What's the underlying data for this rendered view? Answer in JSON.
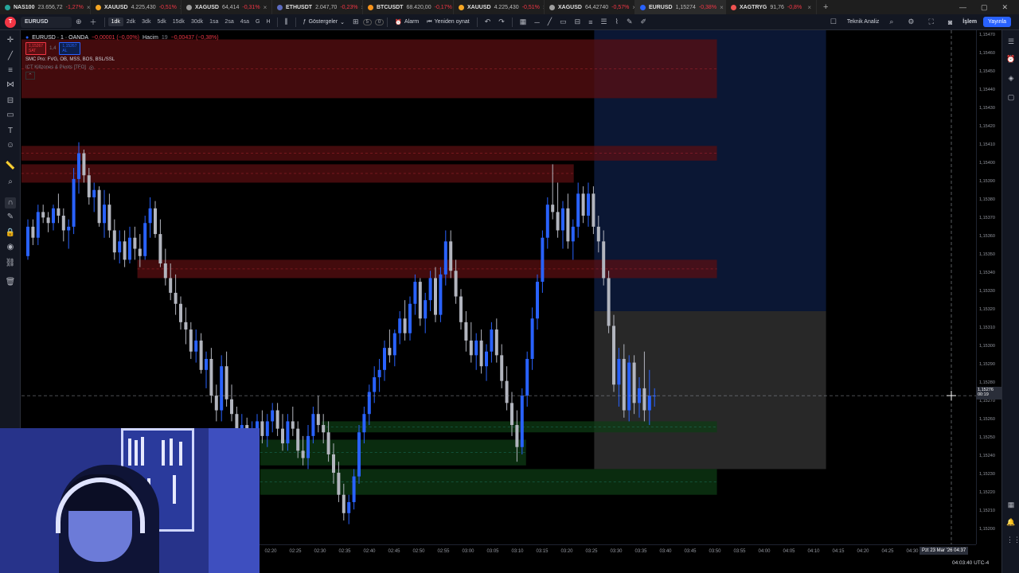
{
  "browser_tabs": [
    {
      "symbol": "NAS100",
      "price": "23.656,72",
      "change": "-1,27%",
      "color": "#26a69a"
    },
    {
      "symbol": "XAUUSD",
      "price": "4.225,430",
      "change": "-0,51%",
      "color": "#f5a623"
    },
    {
      "symbol": "XAGUSD",
      "price": "64,414",
      "change": "-0,31%",
      "color": "#9e9e9e"
    },
    {
      "symbol": "ETHUSDT",
      "price": "2.047,70",
      "change": "-0,23%",
      "color": "#5c6bc0"
    },
    {
      "symbol": "BTCUSDT",
      "price": "68.420,00",
      "change": "-0,17%",
      "color": "#f7931a"
    },
    {
      "symbol": "XAUUSD",
      "price": "4.225,430",
      "change": "-0,51%",
      "color": "#f5a623"
    },
    {
      "symbol": "XAGUSD",
      "price": "64,42740",
      "change": "-0,57%",
      "color": "#9e9e9e"
    },
    {
      "symbol": "EURUSD",
      "price": "1,15274",
      "change": "-0,38%",
      "color": "#2962ff",
      "active": true
    },
    {
      "symbol": "XAGTRYG",
      "price": "91,76",
      "change": "-0,8%",
      "color": "#ef5350"
    }
  ],
  "toolbar": {
    "symbol": "EURUSD",
    "timeframes": [
      "1dk",
      "2dk",
      "3dk",
      "5dk",
      "15dk",
      "30dk",
      "1sa",
      "2sa",
      "4sa",
      "G",
      "H"
    ],
    "active_timeframe": "1dk",
    "indicators_label": "Göstergeler",
    "indicator_count": "5",
    "indicator_count2": "0",
    "alarm_label": "Alarm",
    "replay_label": "Yeniden oynat",
    "tech_analysis_label": "Teknik Analiz",
    "trade_label": "İşlem",
    "publish_label": "Yayınla"
  },
  "legend": {
    "title": "EURUSD · 1 · OANDA",
    "ohlc_change": "−0,00001 (−0,00%)",
    "volume_label": "Hacim",
    "volume_value": "19",
    "change2": "−0,00437 (−0,38%)",
    "sell_price": "1,15267",
    "sell_label": "SAT",
    "spread": "1,4",
    "buy_price": "1,15267",
    "buy_label": "AL",
    "indicator1": "SMC Pro: FVG, OB, MSS, BOS, BSL/SSL",
    "indicator2": "ICT Killzones & Pivots [TFO]"
  },
  "price_axis": {
    "ticks": [
      "1,15470",
      "1,15460",
      "1,15450",
      "1,15440",
      "1,15430",
      "1,15420",
      "1,15410",
      "1,15400",
      "1,15390",
      "1,15380",
      "1,15370",
      "1,15360",
      "1,15350",
      "1,15340",
      "1,15330",
      "1,15320",
      "1,15310",
      "1,15300",
      "1,15290",
      "1,15280",
      "1,15270",
      "1,15260",
      "1,15250",
      "1,15240",
      "1,15230",
      "1,15220",
      "1,15210",
      "1,15200"
    ],
    "current_price": "1,15276",
    "countdown": "00:19"
  },
  "time_axis": {
    "ticks": [
      "02:20",
      "02:25",
      "02:30",
      "02:35",
      "02:40",
      "02:45",
      "02:50",
      "02:55",
      "03:00",
      "03:05",
      "03:10",
      "03:15",
      "03:20",
      "03:25",
      "03:30",
      "03:35",
      "03:40",
      "03:45",
      "03:50",
      "03:55",
      "04:00",
      "04:05",
      "04:10",
      "04:15",
      "04:20",
      "04:25",
      "04:30"
    ],
    "date_tag": "Pzt 23 Mar '26  04:37",
    "clock": "04:03:40 UTC-4"
  },
  "colors": {
    "bull": "#2962ff",
    "bear": "#b2b5be",
    "supply_zone": "#5a0f12",
    "demand_zone": "#0d3b14",
    "target_zone": "#0c1a3a",
    "stop_zone": "#2f2f2f"
  },
  "chart_data": {
    "type": "candlestick",
    "title": "EURUSD · 1 · OANDA",
    "x_range": [
      "02:13",
      "04:33"
    ],
    "ylim": [
      1.15195,
      1.15475
    ],
    "candles": [
      [
        1.15352,
        1.15372,
        1.1535,
        1.15368
      ],
      [
        1.15368,
        1.15372,
        1.15358,
        1.15362
      ],
      [
        1.15362,
        1.1538,
        1.15358,
        1.15376
      ],
      [
        1.15376,
        1.1538,
        1.1537,
        1.15373
      ],
      [
        1.15373,
        1.15376,
        1.15365,
        1.1537
      ],
      [
        1.1537,
        1.1538,
        1.15366,
        1.15378
      ],
      [
        1.15378,
        1.15386,
        1.1537,
        1.15374
      ],
      [
        1.15374,
        1.15378,
        1.1536,
        1.15366
      ],
      [
        1.15366,
        1.15372,
        1.15356,
        1.15368
      ],
      [
        1.15368,
        1.154,
        1.15364,
        1.15394
      ],
      [
        1.15394,
        1.15414,
        1.15386,
        1.15408
      ],
      [
        1.15408,
        1.1541,
        1.15392,
        1.15396
      ],
      [
        1.15396,
        1.154,
        1.1538,
        1.15384
      ],
      [
        1.15384,
        1.15392,
        1.15376,
        1.15388
      ],
      [
        1.15388,
        1.1539,
        1.15368,
        1.1537
      ],
      [
        1.1537,
        1.15388,
        1.15362,
        1.1538
      ],
      [
        1.1538,
        1.15386,
        1.15362,
        1.15366
      ],
      [
        1.15366,
        1.15372,
        1.1535,
        1.15354
      ],
      [
        1.15354,
        1.15366,
        1.15348,
        1.1536
      ],
      [
        1.1536,
        1.15366,
        1.15346,
        1.1535
      ],
      [
        1.1535,
        1.15368,
        1.15348,
        1.15362
      ],
      [
        1.15362,
        1.15368,
        1.1535,
        1.15356
      ],
      [
        1.15356,
        1.15364,
        1.15346,
        1.15352
      ],
      [
        1.15352,
        1.15374,
        1.1535,
        1.1537
      ],
      [
        1.1537,
        1.15384,
        1.15362,
        1.15378
      ],
      [
        1.15378,
        1.15382,
        1.15362,
        1.15364
      ],
      [
        1.15364,
        1.15372,
        1.15346,
        1.15348
      ],
      [
        1.15348,
        1.15356,
        1.15336,
        1.1534
      ],
      [
        1.1534,
        1.15348,
        1.15328,
        1.15332
      ],
      [
        1.15332,
        1.15342,
        1.1532,
        1.15326
      ],
      [
        1.15326,
        1.1533,
        1.15312,
        1.15316
      ],
      [
        1.15316,
        1.15324,
        1.15304,
        1.15312
      ],
      [
        1.15312,
        1.15316,
        1.15296,
        1.153
      ],
      [
        1.153,
        1.15312,
        1.15294,
        1.15306
      ],
      [
        1.15306,
        1.1531,
        1.15288,
        1.1529
      ],
      [
        1.1529,
        1.153,
        1.1528,
        1.15296
      ],
      [
        1.15296,
        1.15302,
        1.15272,
        1.15276
      ],
      [
        1.15276,
        1.15282,
        1.15262,
        1.15268
      ],
      [
        1.15268,
        1.15298,
        1.15262,
        1.15292
      ],
      [
        1.15292,
        1.153,
        1.1527,
        1.15274
      ],
      [
        1.15274,
        1.15282,
        1.15262,
        1.15266
      ],
      [
        1.15266,
        1.1527,
        1.15252,
        1.15256
      ],
      [
        1.15256,
        1.15266,
        1.1525,
        1.1526
      ],
      [
        1.1526,
        1.15264,
        1.15244,
        1.15248
      ],
      [
        1.15248,
        1.15262,
        1.15238,
        1.15256
      ],
      [
        1.15256,
        1.15266,
        1.1525,
        1.15262
      ],
      [
        1.15262,
        1.15268,
        1.1525,
        1.15254
      ],
      [
        1.15254,
        1.15266,
        1.15248,
        1.15262
      ],
      [
        1.15262,
        1.15272,
        1.15256,
        1.15268
      ],
      [
        1.15268,
        1.15272,
        1.15254,
        1.15258
      ],
      [
        1.15258,
        1.15266,
        1.15246,
        1.1525
      ],
      [
        1.1525,
        1.15266,
        1.15246,
        1.15262
      ],
      [
        1.15262,
        1.1527,
        1.15254,
        1.15258
      ],
      [
        1.15258,
        1.15262,
        1.15242,
        1.15246
      ],
      [
        1.15246,
        1.15254,
        1.15238,
        1.15242
      ],
      [
        1.15242,
        1.1526,
        1.15236,
        1.15254
      ],
      [
        1.15254,
        1.1527,
        1.1525,
        1.15266
      ],
      [
        1.15266,
        1.15276,
        1.15256,
        1.1526
      ],
      [
        1.1526,
        1.15266,
        1.1525,
        1.15256
      ],
      [
        1.15256,
        1.15262,
        1.1524,
        1.15244
      ],
      [
        1.15244,
        1.1525,
        1.15228,
        1.15234
      ],
      [
        1.15234,
        1.1524,
        1.15218,
        1.15222
      ],
      [
        1.15222,
        1.15228,
        1.15208,
        1.15212
      ],
      [
        1.15212,
        1.15222,
        1.15206,
        1.15218
      ],
      [
        1.15218,
        1.15236,
        1.15214,
        1.15232
      ],
      [
        1.15232,
        1.1526,
        1.15228,
        1.15256
      ],
      [
        1.15256,
        1.1527,
        1.1525,
        1.15266
      ],
      [
        1.15266,
        1.15282,
        1.1526,
        1.15278
      ],
      [
        1.15278,
        1.15292,
        1.15272,
        1.15286
      ],
      [
        1.15286,
        1.15296,
        1.15278,
        1.1529
      ],
      [
        1.1529,
        1.15306,
        1.15284,
        1.15302
      ],
      [
        1.15302,
        1.15312,
        1.15294,
        1.15298
      ],
      [
        1.15298,
        1.15312,
        1.15292,
        1.1531
      ],
      [
        1.1531,
        1.15322,
        1.15304,
        1.15318
      ],
      [
        1.15318,
        1.15328,
        1.15306,
        1.1531
      ],
      [
        1.1531,
        1.1533,
        1.15306,
        1.15326
      ],
      [
        1.15326,
        1.15342,
        1.1532,
        1.15338
      ],
      [
        1.15338,
        1.1534,
        1.15314,
        1.15318
      ],
      [
        1.15318,
        1.15332,
        1.1531,
        1.15328
      ],
      [
        1.15328,
        1.15344,
        1.15322,
        1.1534
      ],
      [
        1.1534,
        1.15346,
        1.15316,
        1.1532
      ],
      [
        1.1532,
        1.15346,
        1.15316,
        1.15342
      ],
      [
        1.15342,
        1.15366,
        1.15336,
        1.1536
      ],
      [
        1.1536,
        1.15366,
        1.1534,
        1.15344
      ],
      [
        1.15344,
        1.1535,
        1.15326,
        1.1533
      ],
      [
        1.1533,
        1.15334,
        1.15312,
        1.15316
      ],
      [
        1.15316,
        1.15322,
        1.153,
        1.15306
      ],
      [
        1.15306,
        1.15316,
        1.15294,
        1.15298
      ],
      [
        1.15298,
        1.1531,
        1.1529,
        1.15306
      ],
      [
        1.15306,
        1.15312,
        1.15288,
        1.15292
      ],
      [
        1.15292,
        1.15304,
        1.15284,
        1.153
      ],
      [
        1.153,
        1.15316,
        1.15294,
        1.15312
      ],
      [
        1.15312,
        1.15318,
        1.15294,
        1.15298
      ],
      [
        1.15298,
        1.15304,
        1.1528,
        1.15284
      ],
      [
        1.15284,
        1.15292,
        1.15268,
        1.15272
      ],
      [
        1.15272,
        1.15278,
        1.15254,
        1.1526
      ],
      [
        1.1526,
        1.15268,
        1.1524,
        1.15248
      ],
      [
        1.15248,
        1.1528,
        1.15244,
        1.15276
      ],
      [
        1.15276,
        1.153,
        1.1527,
        1.15296
      ],
      [
        1.15296,
        1.15324,
        1.1529,
        1.15318
      ],
      [
        1.15318,
        1.15342,
        1.15312,
        1.15338
      ],
      [
        1.15338,
        1.15366,
        1.15332,
        1.15362
      ],
      [
        1.15362,
        1.15384,
        1.15356,
        1.1538
      ],
      [
        1.1538,
        1.15402,
        1.15372,
        1.15376
      ],
      [
        1.15376,
        1.15392,
        1.15362,
        1.15366
      ],
      [
        1.15366,
        1.15382,
        1.15356,
        1.15378
      ],
      [
        1.15378,
        1.15386,
        1.15356,
        1.1536
      ],
      [
        1.1536,
        1.15372,
        1.1535,
        1.15368
      ],
      [
        1.15368,
        1.15392,
        1.15362,
        1.15386
      ],
      [
        1.15386,
        1.1539,
        1.1537,
        1.15374
      ],
      [
        1.15374,
        1.15392,
        1.15368,
        1.15386
      ],
      [
        1.15386,
        1.1539,
        1.15364,
        1.15368
      ],
      [
        1.15368,
        1.15374,
        1.15354,
        1.1536
      ],
      [
        1.1536,
        1.15366,
        1.15336,
        1.1534
      ],
      [
        1.1534,
        1.15344,
        1.1531,
        1.15314
      ],
      [
        1.15314,
        1.1532,
        1.15278,
        1.15282
      ],
      [
        1.15282,
        1.15302,
        1.1527,
        1.15296
      ],
      [
        1.15296,
        1.15304,
        1.15264,
        1.15268
      ],
      [
        1.15268,
        1.15298,
        1.15262,
        1.15294
      ],
      [
        1.15294,
        1.15298,
        1.15266,
        1.15272
      ],
      [
        1.15272,
        1.15286,
        1.15264,
        1.1528
      ],
      [
        1.1528,
        1.153,
        1.15262,
        1.15268
      ],
      [
        1.15268,
        1.1529,
        1.1526,
        1.15276
      ],
      [
        1.15276,
        1.1528,
        1.1527,
        1.15276
      ]
    ],
    "zones": [
      {
        "label": "supply",
        "from": "02:13",
        "to": "03:55",
        "top": 1.1547,
        "bottom": 1.15438
      },
      {
        "label": "supply",
        "from": "02:13",
        "to": "03:55",
        "top": 1.15412,
        "bottom": 1.15404
      },
      {
        "label": "supply",
        "from": "02:13",
        "to": "03:34",
        "top": 1.15402,
        "bottom": 1.15392
      },
      {
        "label": "supply",
        "from": "02:30",
        "to": "03:55",
        "top": 1.1535,
        "bottom": 1.1534
      },
      {
        "label": "demand",
        "from": "02:57",
        "to": "03:55",
        "top": 1.15262,
        "bottom": 1.15256
      },
      {
        "label": "demand",
        "from": "02:48",
        "to": "03:27",
        "top": 1.15252,
        "bottom": 1.15238
      },
      {
        "label": "demand",
        "from": "02:48",
        "to": "03:55",
        "top": 1.15236,
        "bottom": 1.15222
      }
    ],
    "position": {
      "entry": 1.15322,
      "target": 1.15475,
      "stop": 1.15236,
      "from": "03:37",
      "to": "04:11"
    }
  }
}
